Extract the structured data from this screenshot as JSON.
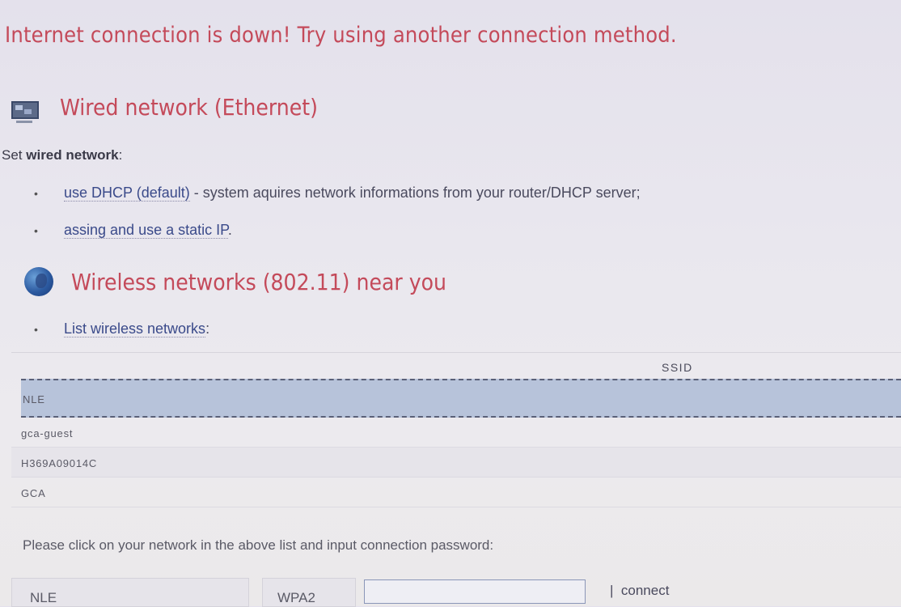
{
  "alert": "Internet connection is down! Try using another connection method.",
  "wired": {
    "title": "Wired network (Ethernet)",
    "set_prefix": "Set ",
    "set_bold": "wired network",
    "set_suffix": ":",
    "options": [
      {
        "link": "use DHCP (default)",
        "text": " - system aquires network informations from your router/DHCP server;"
      },
      {
        "link": "assing and use a static IP",
        "text": "."
      }
    ]
  },
  "wireless": {
    "title": "Wireless networks (802.11) near you",
    "list_link": "List wireless networks",
    "list_suffix": ":",
    "column_header": "SSID",
    "networks": [
      "NLE",
      "gca-guest",
      "H369A09014C",
      "GCA"
    ],
    "selected_index": 0,
    "instruction": "Please click on your network in the above list and input connection password:",
    "form": {
      "ssid": "NLE",
      "encryption": "WPA2",
      "password": "",
      "separator": "|",
      "connect_label": "connect"
    }
  }
}
